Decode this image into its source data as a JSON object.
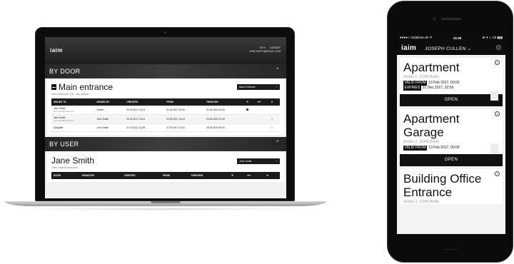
{
  "laptop": {
    "header": {
      "logo": "iaim",
      "lang": "EN  ▾",
      "logout": "LOGOUT",
      "email": "JANE.SMITH@EMAIL.COM"
    },
    "by_door": {
      "section_title": "BY DOOR",
      "door_name": "Main entrance",
      "door_sub": "Main Road Ave. 100 · key options",
      "select_value": "Main Entrance",
      "columns": [
        "ISSUED TO",
        "ISSUED BY",
        "CREATED",
        "FROM",
        "THROUGH",
        "",
        "",
        ""
      ],
      "rows": [
        {
          "to": "John Smith",
          "to_sub": "john.smith@email.com",
          "by": "Owner",
          "created": "20.02.2017 13:24",
          "from": "21.02.2017 14:00",
          "through": "21.03.2018 14:00"
        },
        {
          "to": "Jane Smith",
          "to_sub": "jane.smith@email.com",
          "by": "John Smith",
          "created": "20.02.2017 13:24",
          "from": "20.02.2017 13:24",
          "through": "20.03.2020 22:45"
        },
        {
          "to": "Daughter",
          "to_sub": "",
          "by": "John Smith",
          "created": "27.02.2017 12:38",
          "from": "27.02.2017 01:00",
          "through": "29.03.2020 09:00"
        }
      ]
    },
    "by_user": {
      "section_title": "BY USER",
      "user_name": "Jane Smith",
      "user_sub": "Jane.Smith@email.com",
      "select_value": "Jane Smith",
      "columns": [
        "DOOR",
        "ISSUED BY",
        "CREATED",
        "FROM",
        "THROUGH",
        "",
        "",
        ""
      ]
    }
  },
  "phone": {
    "status": {
      "carrier": "●●●●○ Vodafone.de ᯤ",
      "time": "15:09",
      "right": "⊕ ✈ ◐ C8 ▮▮▮"
    },
    "nav": {
      "logo": "iaim",
      "user": "JOSEPH CULLEN  ⌄",
      "gear": "⚙"
    },
    "cards": [
      {
        "name": "Apartment",
        "address": "Straße 1, 12345 Berlin",
        "valid_label": "VALID FROM",
        "valid": "13 Feb 2017, 00:00",
        "expires_label": "EXPIRES",
        "expires": "31 Dec 2017, 22:59",
        "button": "OPEN"
      },
      {
        "name": "Apartment Garage",
        "address": "Straße 2, 12345 Berlin",
        "valid_label": "VALID FROM",
        "valid": "13 Feb 2017, 00:00",
        "button": "OPEN"
      },
      {
        "name": "Building Office Entrance",
        "address": "Straße 3, 12345 Berlin"
      }
    ]
  },
  "colors": {
    "accent": "#111111",
    "bg": "#f3f3f3"
  }
}
